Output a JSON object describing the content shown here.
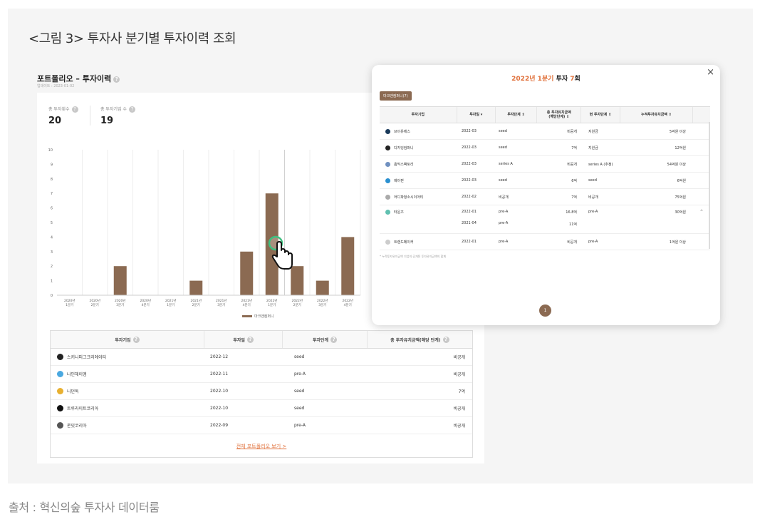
{
  "figure_title": "<그림 3> 투자사 분기별 투자이력 조회",
  "source": "출처 : 혁신의숲 투자사 데이터룸",
  "portfolio": {
    "title": "포트폴리오 – 투자이력",
    "date": "업데이트 : 2023-01-02",
    "stats": [
      {
        "label": "총 투자횟수",
        "value": "20"
      },
      {
        "label": "총 투자기업 수",
        "value": "19"
      }
    ],
    "legend": "마크앤컴퍼니",
    "view_all": "전체 포트폴리오 보기  >"
  },
  "chart_data": {
    "type": "bar",
    "categories": [
      "2020년\n1분기",
      "2020년\n2분기",
      "2020년\n3분기",
      "2020년\n4분기",
      "2021년\n1분기",
      "2021년\n2분기",
      "2021년\n3분기",
      "2021년\n4분기",
      "2022년\n1분기",
      "2022년\n2분기",
      "2022년\n3분기",
      "2022년\n4분기"
    ],
    "values": [
      0,
      0,
      2,
      0,
      0,
      1,
      0,
      3,
      7,
      2,
      1,
      4
    ],
    "yticks": [
      "0",
      "1",
      "2",
      "3",
      "4",
      "5",
      "6",
      "7",
      "8",
      "9",
      "10"
    ],
    "ylim": [
      0,
      10
    ],
    "series": [
      {
        "name": "마크앤컴퍼니",
        "color": "#8b6a52"
      }
    ]
  },
  "portfolio_table": {
    "headers": [
      "투자기업",
      "투자일",
      "투자단계",
      "총 투자유치금액(해당 단계)"
    ],
    "rows": [
      {
        "company": "스키니피그크리에이티",
        "date": "2022-12",
        "stage": "seed",
        "amount": "비공개",
        "color": "#222222"
      },
      {
        "company": "나인헤이엠",
        "date": "2022-11",
        "stage": "pre-A",
        "amount": "비공개",
        "color": "#4aa8e0"
      },
      {
        "company": "니던독",
        "date": "2022-10",
        "stage": "seed",
        "amount": "7억",
        "color": "#e8b030"
      },
      {
        "company": "트루라이트코리아",
        "date": "2022-10",
        "stage": "seed",
        "amount": "비공개",
        "color": "#111111"
      },
      {
        "company": "온잇코리아",
        "date": "2022-09",
        "stage": "pre-A",
        "amount": "비공개",
        "color": "#555555"
      }
    ]
  },
  "modal": {
    "title_accent": "2022년 1분기",
    "title_mid": " 투자 ",
    "title_count": "7",
    "title_suffix": "회",
    "close": "×",
    "company_tag": "마크앤컴퍼니(7)",
    "headers": [
      "투자기업",
      "투자일 ▾",
      "투자단계 ⇕",
      "총 투자유치금액\n(해당단계)  ⇕",
      "현 투자단계 ⇕",
      "누적투자유치금액 ⇕"
    ],
    "rows": [
      {
        "company": "브이유에스",
        "date": "2022-03",
        "stage": "seed",
        "amount": "비공개",
        "current": "지원금",
        "total": "5억원 이상",
        "color": "#1a3a5a"
      },
      {
        "company": "디자잉컴퍼니",
        "date": "2022-03",
        "stage": "seed",
        "amount": "7억",
        "current": "지원금",
        "total": "12억원",
        "color": "#222222"
      },
      {
        "company": "홈믹스팩토리",
        "date": "2022-03",
        "stage": "series A",
        "amount": "비공개",
        "current": "series A (추정)",
        "total": "54억원 이상",
        "color": "#7090c0"
      },
      {
        "company": "제이펀",
        "date": "2022-03",
        "stage": "seed",
        "amount": "6억",
        "current": "seed",
        "total": "6억원",
        "color": "#2a90d0"
      },
      {
        "company": "어디파청소시이어티",
        "date": "2022-02",
        "stage": "비공개",
        "amount": "7억",
        "current": "비공개",
        "total": "75억원",
        "color": "#aaaaaa"
      },
      {
        "company": "타운즈",
        "date": "2022-01",
        "stage": "pre-A",
        "amount": "16.8억",
        "current": "pre-A",
        "total": "30억원",
        "color": "#60c0b0",
        "sub_date": "2021-04",
        "sub_stage": "pre-A",
        "sub_amount": "11억",
        "expand": "^"
      },
      {
        "company": "트랜드메이커",
        "date": "2022-01",
        "stage": "pre-A",
        "amount": "비공개",
        "current": "pre-A",
        "total": "1억원 이상",
        "color": "#cccccc"
      }
    ],
    "footnote": "* 누적투자유치금액 기업의 공개된 투자유치금액의 합계",
    "page": "1"
  }
}
